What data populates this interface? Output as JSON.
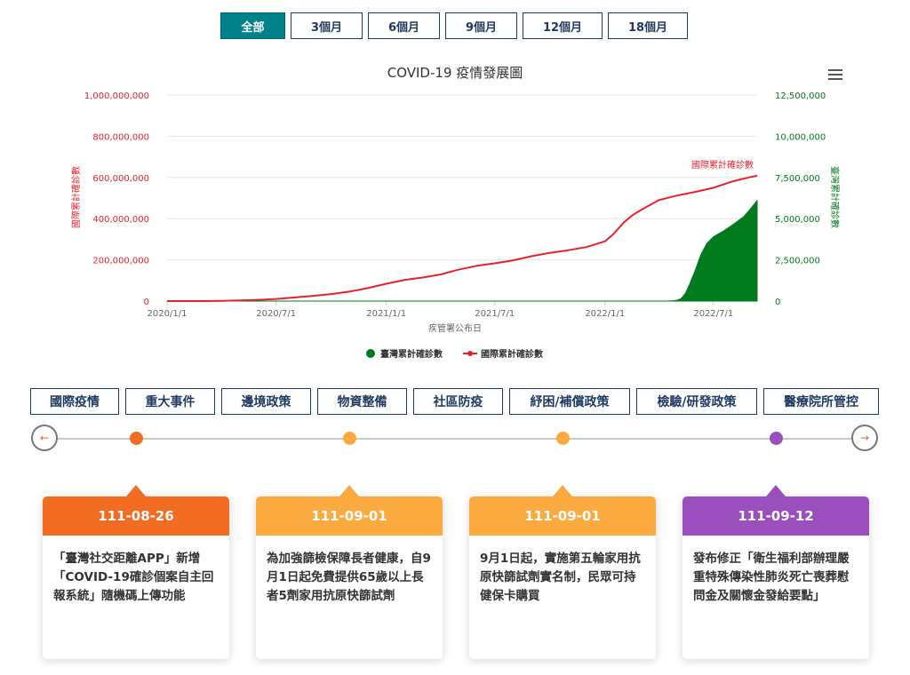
{
  "ranges": [
    "全部",
    "3個月",
    "6個月",
    "9個月",
    "12個月",
    "18個月"
  ],
  "colors": {
    "accent": "#00828a",
    "navy": "#1e3a5f",
    "taiwan": "#007a1d",
    "international": "#e8202e",
    "orange_dark": "#f26c22",
    "orange_light": "#fbaa3f",
    "purple": "#9b4fbe"
  },
  "chart_data": {
    "type": "area",
    "title": "COVID-19 疫情發展圖",
    "xlabel": "疾管署公布日",
    "ylabel_left": "國際累計確診數",
    "ylabel_right": "臺灣累計確診數",
    "x_ticks": [
      "2020/1/1",
      "2020/7/1",
      "2021/1/1",
      "2021/7/1",
      "2022/1/1",
      "2022/7/1"
    ],
    "y_left_ticks": [
      "0",
      "200,000,000",
      "400,000,000",
      "600,000,000",
      "800,000,000",
      "1,000,000,000"
    ],
    "y_right_ticks": [
      "0",
      "2,500,000",
      "5,000,000",
      "7,500,000",
      "10,000,000",
      "12,500,000"
    ],
    "ylim_left": [
      0,
      1000000000
    ],
    "ylim_right": [
      0,
      12500000
    ],
    "x_range": [
      "2020-01-01",
      "2022-09-12"
    ],
    "series": [
      {
        "name": "臺灣累計確診數",
        "axis": "right",
        "type": "area",
        "color": "#007a1d",
        "points": [
          [
            "2020-01-01",
            0
          ],
          [
            "2022-04-15",
            0
          ],
          [
            "2022-04-25",
            20000
          ],
          [
            "2022-05-01",
            50000
          ],
          [
            "2022-05-08",
            150000
          ],
          [
            "2022-05-15",
            450000
          ],
          [
            "2022-05-22",
            1000000
          ],
          [
            "2022-05-31",
            1800000
          ],
          [
            "2022-06-10",
            2800000
          ],
          [
            "2022-06-20",
            3500000
          ],
          [
            "2022-07-01",
            3900000
          ],
          [
            "2022-07-20",
            4300000
          ],
          [
            "2022-08-01",
            4600000
          ],
          [
            "2022-08-20",
            5100000
          ],
          [
            "2022-09-01",
            5600000
          ],
          [
            "2022-09-12",
            6100000
          ]
        ]
      },
      {
        "name": "國際累計確診數",
        "axis": "left",
        "type": "line",
        "color": "#e8202e",
        "points": [
          [
            "2020-01-01",
            0
          ],
          [
            "2020-03-01",
            100000
          ],
          [
            "2020-04-01",
            1000000
          ],
          [
            "2020-05-01",
            3300000
          ],
          [
            "2020-06-01",
            6200000
          ],
          [
            "2020-07-01",
            10500000
          ],
          [
            "2020-08-01",
            17500000
          ],
          [
            "2020-09-01",
            25500000
          ],
          [
            "2020-10-01",
            34000000
          ],
          [
            "2020-11-01",
            46000000
          ],
          [
            "2020-12-01",
            63000000
          ],
          [
            "2021-01-01",
            84000000
          ],
          [
            "2021-02-01",
            103000000
          ],
          [
            "2021-03-01",
            114000000
          ],
          [
            "2021-04-01",
            129000000
          ],
          [
            "2021-05-01",
            152000000
          ],
          [
            "2021-06-01",
            171000000
          ],
          [
            "2021-07-01",
            183000000
          ],
          [
            "2021-08-01",
            198000000
          ],
          [
            "2021-09-01",
            218000000
          ],
          [
            "2021-10-01",
            234000000
          ],
          [
            "2021-11-01",
            247000000
          ],
          [
            "2021-12-01",
            262000000
          ],
          [
            "2022-01-01",
            290000000
          ],
          [
            "2022-01-15",
            325000000
          ],
          [
            "2022-02-01",
            380000000
          ],
          [
            "2022-02-15",
            415000000
          ],
          [
            "2022-03-01",
            440000000
          ],
          [
            "2022-04-01",
            490000000
          ],
          [
            "2022-05-01",
            512000000
          ],
          [
            "2022-06-01",
            530000000
          ],
          [
            "2022-07-01",
            550000000
          ],
          [
            "2022-08-01",
            580000000
          ],
          [
            "2022-09-01",
            602000000
          ],
          [
            "2022-09-12",
            608000000
          ]
        ]
      }
    ],
    "annotations": [
      {
        "text": "國際累計確診數",
        "series": "國際累計確診數"
      }
    ],
    "legend": {
      "position": "bottom"
    },
    "grid": true
  },
  "categories": [
    "國際疫情",
    "重大事件",
    "邊境政策",
    "物資整備",
    "社區防疫",
    "紓困/補償政策",
    "檢驗/研發政策",
    "醫療院所管控"
  ],
  "timeline": {
    "prev_label": "←",
    "next_label": "→",
    "events": [
      {
        "date": "111-08-26",
        "color": "#f26c22",
        "text": "「臺灣社交距離APP」新增「COVID-19確診個案自主回報系統」隨機碼上傳功能"
      },
      {
        "date": "111-09-01",
        "color": "#fbaa3f",
        "text": "為加強篩檢保障長者健康，自9月1日起免費提供65歲以上長者5劑家用抗原快篩試劑"
      },
      {
        "date": "111-09-01",
        "color": "#fbaa3f",
        "text": "9月1日起，實施第五輪家用抗原快篩試劑實名制，民眾可持健保卡購買"
      },
      {
        "date": "111-09-12",
        "color": "#9b4fbe",
        "text": "發布修正「衛生福利部辦理嚴重特殊傳染性肺炎死亡喪葬慰問金及關懷金發給要點」"
      }
    ]
  }
}
